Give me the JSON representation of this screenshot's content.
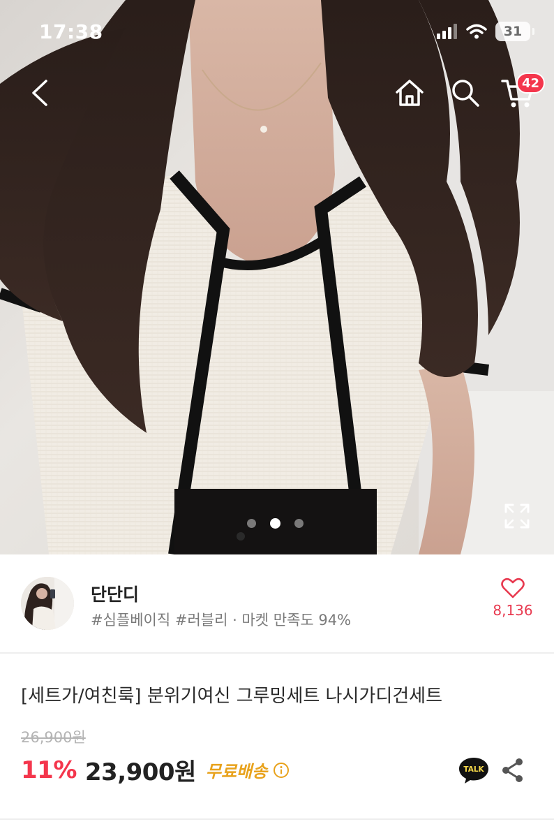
{
  "status_bar": {
    "time": "17:38",
    "battery": "31",
    "icons": [
      "signal-icon",
      "wifi-icon",
      "battery-icon"
    ]
  },
  "nav": {
    "icons": [
      "back-icon",
      "home-icon",
      "search-icon",
      "cart-icon"
    ],
    "cart_count": "42"
  },
  "gallery": {
    "image_count": 3,
    "active_index": 1,
    "expand_icon": "expand-icon"
  },
  "seller": {
    "name": "단단디",
    "tags": "#심플베이직 #러블리 · 마켓 만족도 94%",
    "like_count": "8,136",
    "like_icon": "heart-icon"
  },
  "product": {
    "title": "[세트가/여친룩] 분위기여신 그루밍세트 나시가디건세트",
    "original_price": "26,900원",
    "discount": "11%",
    "price": "23,900원",
    "shipping": "무료배송",
    "talk_label": "TALK"
  },
  "colors": {
    "accent": "#f4364c",
    "shipping": "#e8a21c",
    "muted": "#b4b4b4"
  }
}
